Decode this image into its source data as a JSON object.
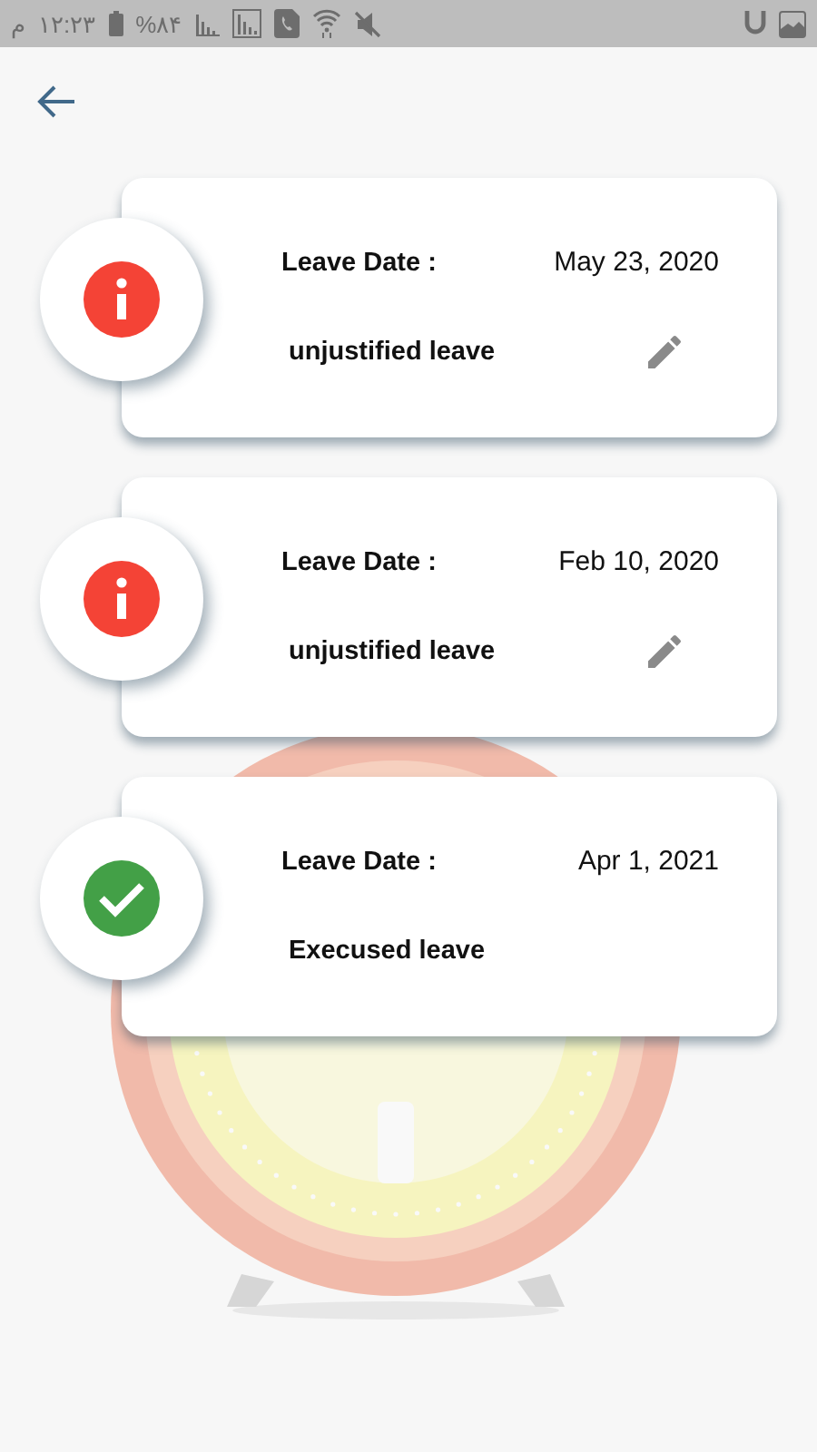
{
  "status_bar": {
    "period": "م",
    "time": "۱۲:۲۳",
    "battery": "%۸۴"
  },
  "leaves": [
    {
      "kind": "unjustified",
      "date_label": "Leave Date :",
      "date": "May 23, 2020",
      "type": "unjustified leave",
      "editable": true
    },
    {
      "kind": "unjustified",
      "date_label": "Leave Date :",
      "date": "Feb 10, 2020",
      "type": "unjustified leave",
      "editable": true
    },
    {
      "kind": "excused",
      "date_label": "Leave Date :",
      "date": "Apr 1, 2021",
      "type": "Execused leave",
      "editable": false
    }
  ]
}
